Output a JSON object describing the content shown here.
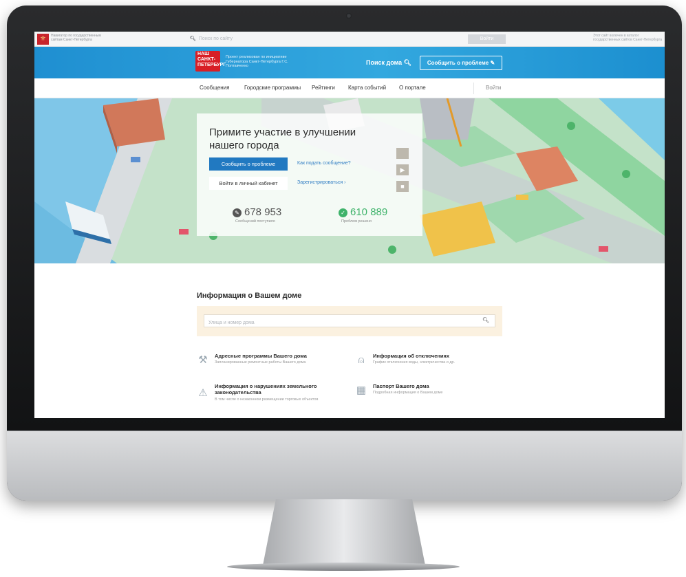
{
  "topbar": {
    "navigator_text": "Навигатор по государственным сайтам Санкт-Петербурга",
    "search_placeholder": "Поиск по сайту",
    "login_button": "Войти",
    "right_note": "Этот сайт включен в каталог государственных сайтов Санкт-Петербурга"
  },
  "header": {
    "brand_lines": [
      "НАШ",
      "САНКТ-",
      "ПЕТЕРБУРГ"
    ],
    "project_text": "Проект реализован по инициативе Губернатора Санкт-Петербурга Г.С. Полтавченко",
    "search_label": "Поиск дома",
    "report_button": "Сообщить о проблеме",
    "accent_color": "#1f8fd1",
    "brand_color": "#d81f26"
  },
  "nav": {
    "items": [
      "Сообщения",
      "Городские программы",
      "Рейтинги",
      "Карта событий",
      "О портале"
    ],
    "login": "Войти"
  },
  "hero": {
    "title": "Примите участие в улучшении нашего города",
    "report_button": "Сообщить о проблеме",
    "how_to_link": "Как подать сообщение?",
    "cabinet_button": "Войти в личный кабинет",
    "register_link": "Зарегистрироваться",
    "app_icons": [
      "apple-icon",
      "play-store-icon",
      "windows-icon"
    ],
    "stats": [
      {
        "value": "678 953",
        "label": "Сообщений поступило",
        "icon": "pencil-icon",
        "color": "#555555"
      },
      {
        "value": "610 889",
        "label": "Проблем решено",
        "icon": "check-icon",
        "color": "#3fb36b"
      }
    ]
  },
  "house_info": {
    "title": "Информация о Вашем доме",
    "search_placeholder": "Улица и номер дома",
    "items": [
      {
        "title": "Адресные программы Вашего дома",
        "desc": "Запланированные ремонтные работы Вашего дома",
        "icon": "hammer-icon"
      },
      {
        "title": "Информация об отключениях",
        "desc": "График отключения воды, электричества и др.",
        "icon": "bell-icon"
      },
      {
        "title": "Информация о нарушениях земельного законодательства",
        "desc": "В том числе о незаконном размещении торговых объектов",
        "icon": "warning-icon"
      },
      {
        "title": "Паспорт Вашего дома",
        "desc": "Подробная информация о Вашем доме",
        "icon": "building-icon"
      }
    ]
  }
}
